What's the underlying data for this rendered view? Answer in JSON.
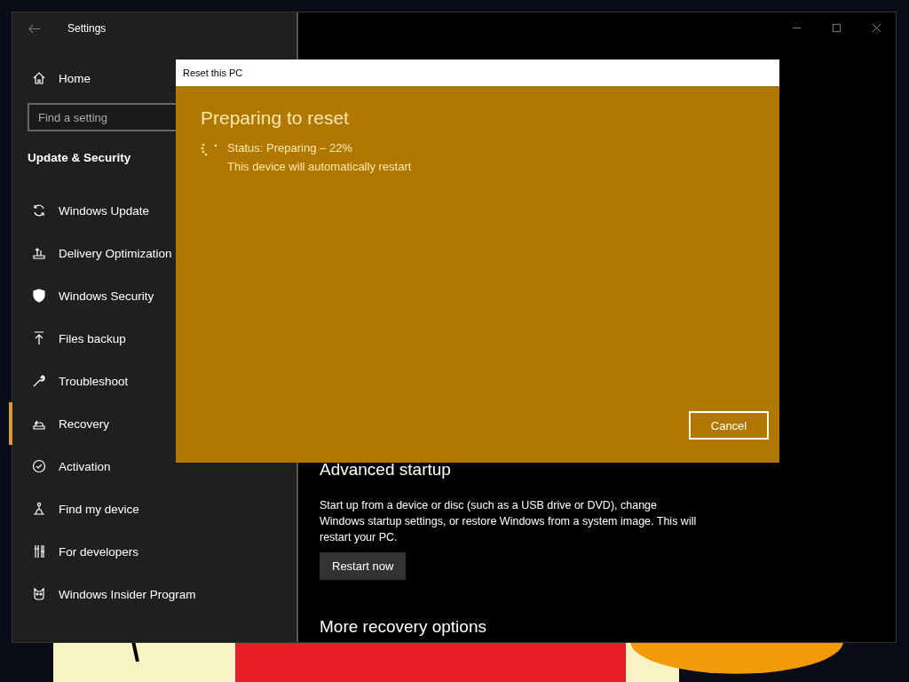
{
  "window": {
    "title": "Settings"
  },
  "sidebar": {
    "home": "Home",
    "search": {
      "placeholder": "Find a setting"
    },
    "section": "Update & Security",
    "items": [
      {
        "label": "Windows Update",
        "selected": false
      },
      {
        "label": "Delivery Optimization",
        "selected": false
      },
      {
        "label": "Windows Security",
        "selected": false
      },
      {
        "label": "Files backup",
        "selected": false
      },
      {
        "label": "Troubleshoot",
        "selected": false
      },
      {
        "label": "Recovery",
        "selected": true
      },
      {
        "label": "Activation",
        "selected": false
      },
      {
        "label": "Find my device",
        "selected": false
      },
      {
        "label": "For developers",
        "selected": false
      },
      {
        "label": "Windows Insider Program",
        "selected": false
      }
    ]
  },
  "content": {
    "heading": "Advanced startup",
    "description": "Start up from a device or disc (such as a USB drive or DVD), change Windows startup settings, or restore Windows from a system image. This will restart your PC.",
    "button": "Restart now",
    "next_heading": "More recovery options"
  },
  "dialog": {
    "title": "Reset this PC",
    "heading": "Preparing to reset",
    "status": "Status: Preparing – 22%",
    "note": "This device will automatically restart",
    "button": "Cancel"
  }
}
